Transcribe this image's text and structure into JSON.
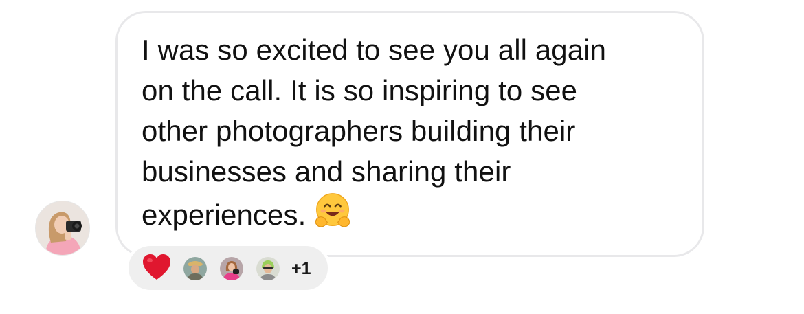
{
  "message": {
    "lines": [
      "I was so excited to see you all again",
      "on the call. It is so inspiring to see",
      "other photographers building their",
      "businesses and sharing their",
      "experiences."
    ],
    "emoji": "smiling-face-with-open-hands"
  },
  "sender": {
    "avatar_icon": "photographer-avatar"
  },
  "reactions": {
    "emoji": "heart",
    "heart_color": "#e0172f",
    "reactor_avatars": [
      "reactor-avatar-1",
      "reactor-avatar-2",
      "reactor-avatar-3"
    ],
    "more_count": "+1"
  },
  "colors": {
    "bubble_border": "#e8e8ea",
    "reaction_pill_bg": "#efefef",
    "text": "#111111"
  }
}
